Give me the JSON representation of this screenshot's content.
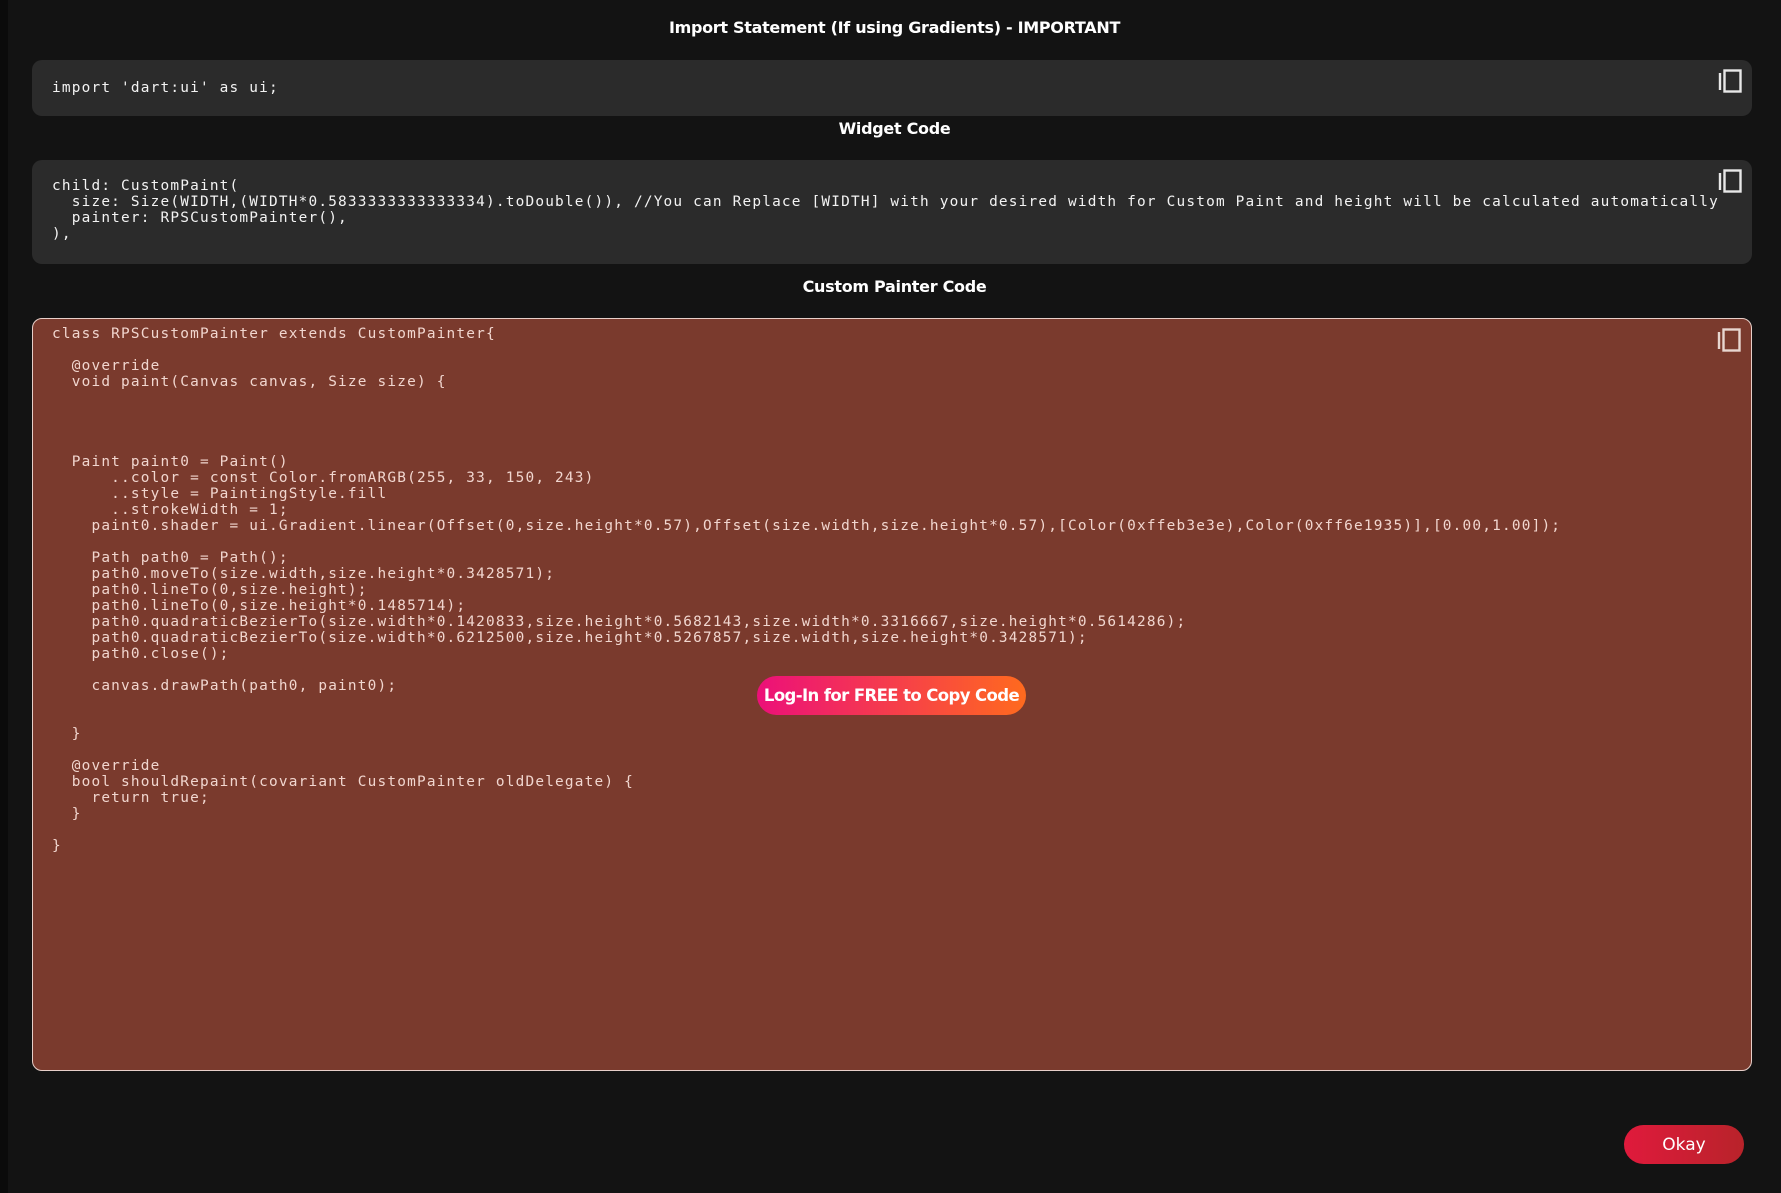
{
  "import_section": {
    "title": "Import Statement (If using Gradients) - IMPORTANT",
    "code": "import 'dart:ui' as ui;"
  },
  "widget_section": {
    "title": "Widget Code",
    "code": "child: CustomPaint(\n  size: Size(WIDTH,(WIDTH*0.5833333333333334).toDouble()), //You can Replace [WIDTH] with your desired width for Custom Paint and height will be calculated automatically\n  painter: RPSCustomPainter(),\n),"
  },
  "painter_section": {
    "title": "Custom Painter Code",
    "code": "class RPSCustomPainter extends CustomPainter{\n\n  @override\n  void paint(Canvas canvas, Size size) {\n\n\n\n\n  Paint paint0 = Paint()\n      ..color = const Color.fromARGB(255, 33, 150, 243)\n      ..style = PaintingStyle.fill\n      ..strokeWidth = 1;\n    paint0.shader = ui.Gradient.linear(Offset(0,size.height*0.57),Offset(size.width,size.height*0.57),[Color(0xffeb3e3e),Color(0xff6e1935)],[0.00,1.00]);\n\n    Path path0 = Path();\n    path0.moveTo(size.width,size.height*0.3428571);\n    path0.lineTo(0,size.height);\n    path0.lineTo(0,size.height*0.1485714);\n    path0.quadraticBezierTo(size.width*0.1420833,size.height*0.5682143,size.width*0.3316667,size.height*0.5614286);\n    path0.quadraticBezierTo(size.width*0.6212500,size.height*0.5267857,size.width,size.height*0.3428571);\n    path0.close();\n\n    canvas.drawPath(path0, paint0);\n\n\n  }\n\n  @override\n  bool shouldRepaint(covariant CustomPainter oldDelegate) {\n    return true;\n  }\n\n}",
    "login_button_label": "Log-In for FREE to Copy Code"
  },
  "footer": {
    "okay_label": "Okay"
  },
  "icons": {
    "copy": "copy-icon"
  },
  "colors": {
    "modal_background": "#131313",
    "code_background": "#2b2b2b",
    "painter_background": "#7a3a2d",
    "login_gradient_start": "#ec1079",
    "login_gradient_end": "#ff6a1e",
    "okay_button": "#d11f33"
  }
}
